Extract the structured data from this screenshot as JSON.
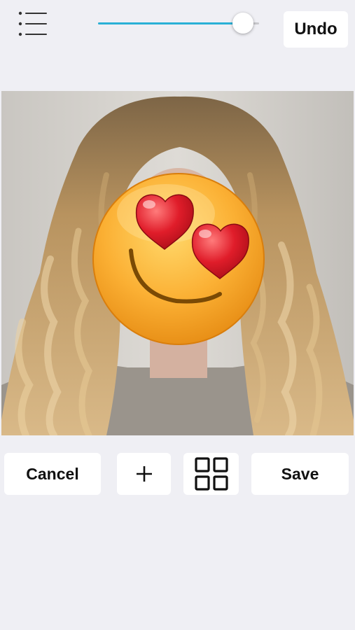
{
  "topbar": {
    "menu_icon": "list-icon",
    "slider": {
      "value": 0.9,
      "accent": "#2ab0d6"
    },
    "undo_label": "Undo"
  },
  "photo": {
    "subject": "woman-with-long-wavy-blonde-hair",
    "face_overlay": "smiling-face-with-heart-eyes-emoji"
  },
  "toolbar": {
    "cancel_label": "Cancel",
    "add_icon": "plus-icon",
    "grid_icon": "grid-icon",
    "save_label": "Save"
  }
}
